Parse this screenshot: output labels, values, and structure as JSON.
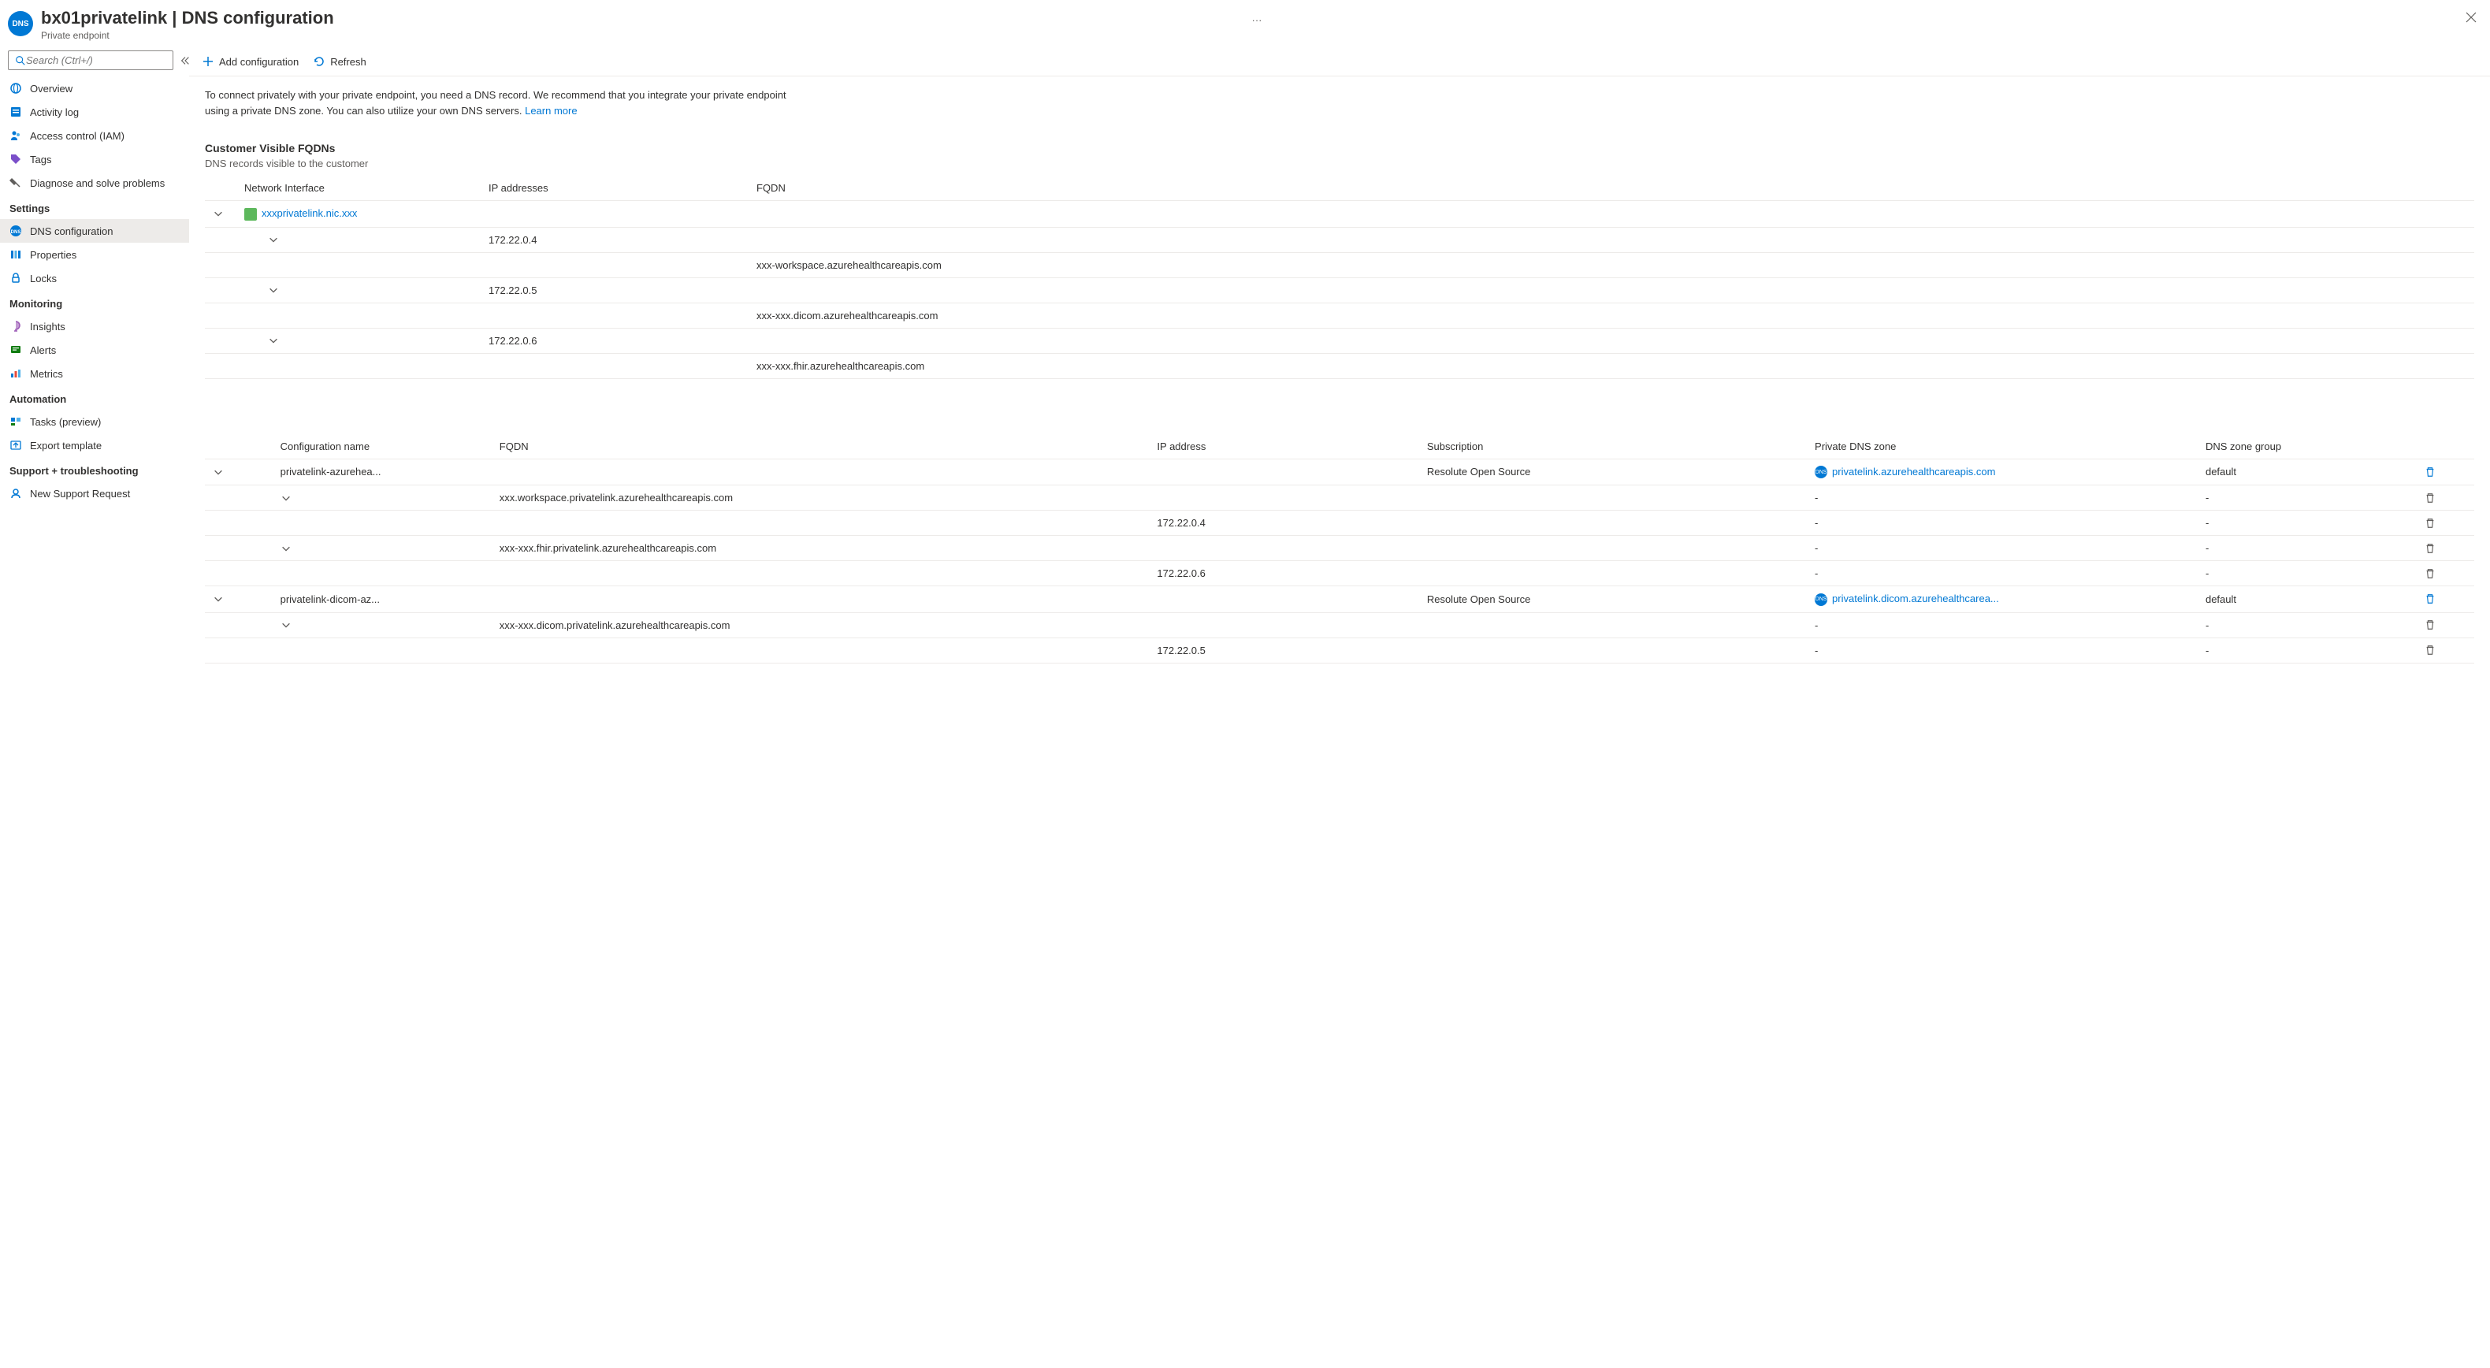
{
  "header": {
    "icon_text": "DNS",
    "title": "bx01privatelink | DNS configuration",
    "subtitle": "Private endpoint"
  },
  "search": {
    "placeholder": "Search (Ctrl+/)"
  },
  "nav": {
    "overview": "Overview",
    "activity_log": "Activity log",
    "iam": "Access control (IAM)",
    "tags": "Tags",
    "diagnose": "Diagnose and solve problems",
    "sec_settings": "Settings",
    "dns_config": "DNS configuration",
    "properties": "Properties",
    "locks": "Locks",
    "sec_monitoring": "Monitoring",
    "insights": "Insights",
    "alerts": "Alerts",
    "metrics": "Metrics",
    "sec_automation": "Automation",
    "tasks": "Tasks (preview)",
    "export_template": "Export template",
    "sec_support": "Support + troubleshooting",
    "new_support": "New Support Request"
  },
  "toolbar": {
    "add": "Add configuration",
    "refresh": "Refresh"
  },
  "intro": {
    "text": "To connect privately with your private endpoint, you need a DNS record. We recommend that you integrate your private endpoint using a private DNS zone. You can also utilize your own DNS servers. ",
    "learn_more": "Learn more"
  },
  "fqdns": {
    "title": "Customer Visible FQDNs",
    "desc": "DNS records visible to the customer",
    "col_nic": "Network Interface",
    "col_ip": "IP addresses",
    "col_fqdn": "FQDN",
    "nic_name": "xxxprivatelink.nic.xxx",
    "rows": [
      {
        "ip": "172.22.0.4",
        "fqdn": "xxx-workspace.azurehealthcareapis.com"
      },
      {
        "ip": "172.22.0.5",
        "fqdn": "xxx-xxx.dicom.azurehealthcareapis.com"
      },
      {
        "ip": "172.22.0.6",
        "fqdn": "xxx-xxx.fhir.azurehealthcareapis.com"
      }
    ]
  },
  "config": {
    "col_name": "Configuration name",
    "col_fqdn": "FQDN",
    "col_ip": "IP address",
    "col_sub": "Subscription",
    "col_zone": "Private DNS zone",
    "col_group": "DNS zone group",
    "dash": "-",
    "rows": {
      "g1_name": "privatelink-azurehea...",
      "g1_sub": "Resolute Open Source",
      "g1_zone": "privatelink.azurehealthcareapis.com",
      "g1_group": "default",
      "r1_fqdn": "xxx.workspace.privatelink.azurehealthcareapis.com",
      "r1_ip": "172.22.0.4",
      "r2_fqdn": "xxx-xxx.fhir.privatelink.azurehealthcareapis.com",
      "r2_ip": "172.22.0.6",
      "g2_name": "privatelink-dicom-az...",
      "g2_sub": "Resolute Open Source",
      "g2_zone": "privatelink.dicom.azurehealthcarea...",
      "g2_group": "default",
      "r3_fqdn": "xxx-xxx.dicom.privatelink.azurehealthcareapis.com",
      "r3_ip": "172.22.0.5"
    }
  }
}
